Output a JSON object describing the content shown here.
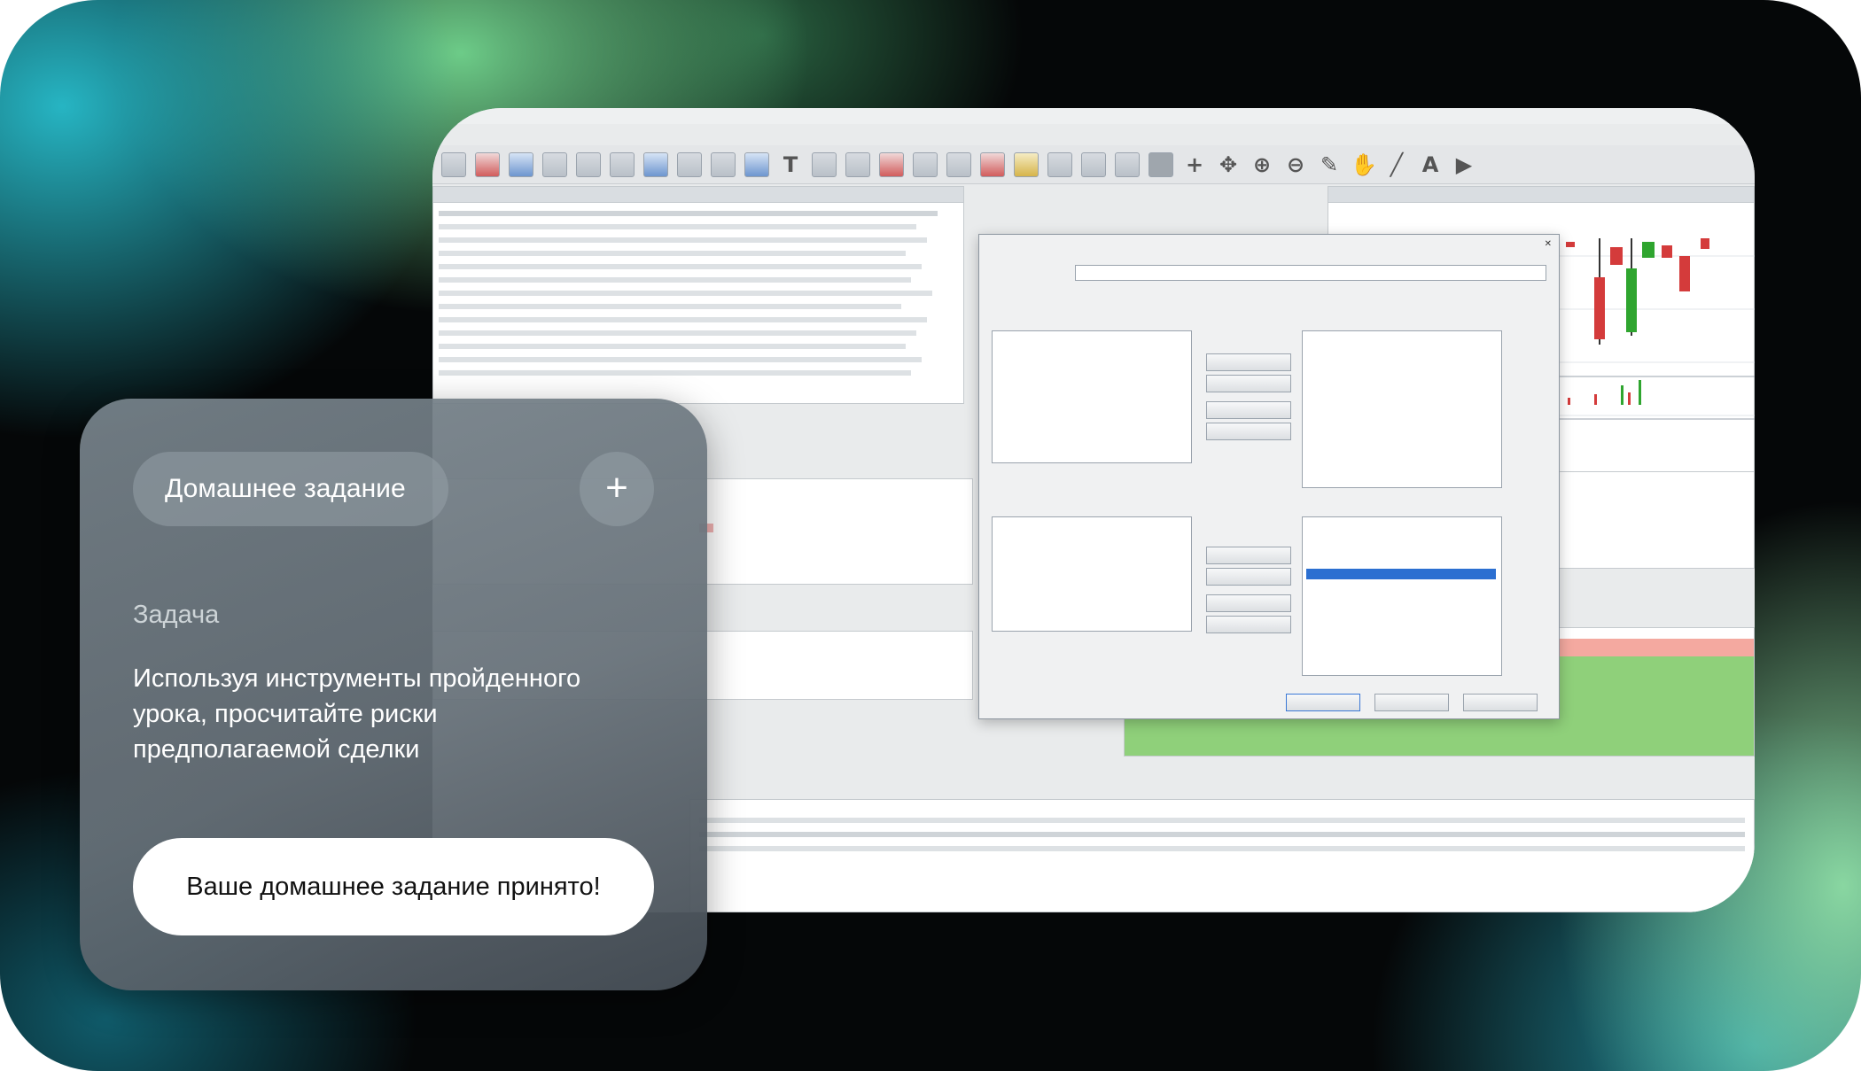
{
  "card": {
    "pill_label": "Домашнее задание",
    "add_symbol": "+",
    "task_label": "Задача",
    "task_text": "Используя инструменты пройденного урока, просчитайте риски предполагаемой сделки",
    "accept_label": "Ваше домашнее задание принято!"
  },
  "colors": {
    "card_bg": "#6b757d",
    "accept_bg": "#ffffff",
    "teal_glow": "#28becd",
    "green_glow": "#78e196"
  }
}
